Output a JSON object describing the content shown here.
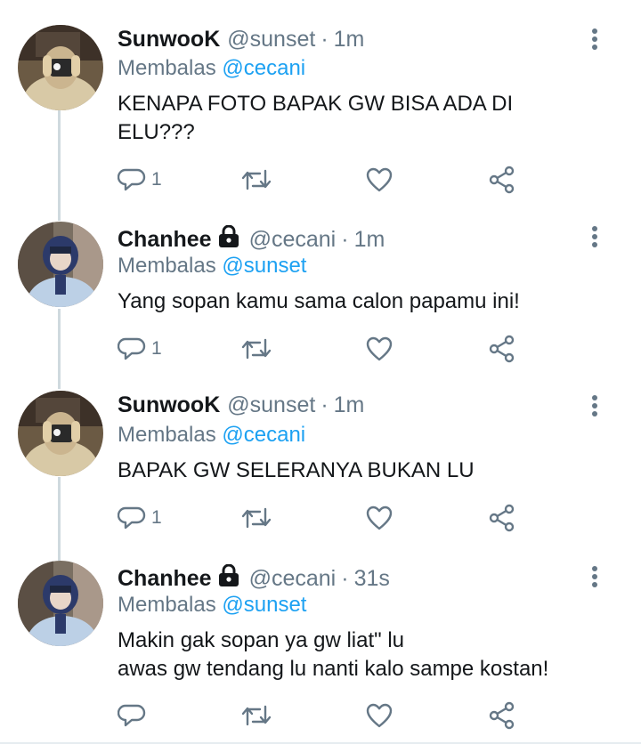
{
  "tweets": [
    {
      "name": "SunwooK",
      "locked": false,
      "handle": "@sunset",
      "time": "1m",
      "reply_prefix": "Membalas",
      "reply_to": "@cecani",
      "text_lines": [
        "KENAPA FOTO BAPAK GW BISA ADA DI",
        "ELU???"
      ],
      "reply_count": "1"
    },
    {
      "name": "Chanhee",
      "locked": true,
      "handle": "@cecani",
      "time": "1m",
      "reply_prefix": "Membalas",
      "reply_to": "@sunset",
      "text_lines": [
        "Yang sopan kamu sama calon papamu ini!"
      ],
      "reply_count": "1"
    },
    {
      "name": "SunwooK",
      "locked": false,
      "handle": "@sunset",
      "time": "1m",
      "reply_prefix": "Membalas",
      "reply_to": "@cecani",
      "text_lines": [
        "BAPAK GW SELERANYA BUKAN LU"
      ],
      "reply_count": "1"
    },
    {
      "name": "Chanhee",
      "locked": true,
      "handle": "@cecani",
      "time": "31s",
      "reply_prefix": "Membalas",
      "reply_to": "@sunset",
      "text_lines": [
        "Makin gak sopan ya gw liat\" lu",
        "awas gw tendang lu nanti kalo sampe kostan!"
      ],
      "reply_count": ""
    }
  ],
  "separator": "·",
  "colors": {
    "accent": "#1da1f2",
    "secondary": "#657786",
    "line": "#cfd9de"
  },
  "icons": [
    "lock-icon",
    "more-vertical-icon",
    "reply-icon",
    "retweet-icon",
    "like-icon",
    "share-icon"
  ]
}
